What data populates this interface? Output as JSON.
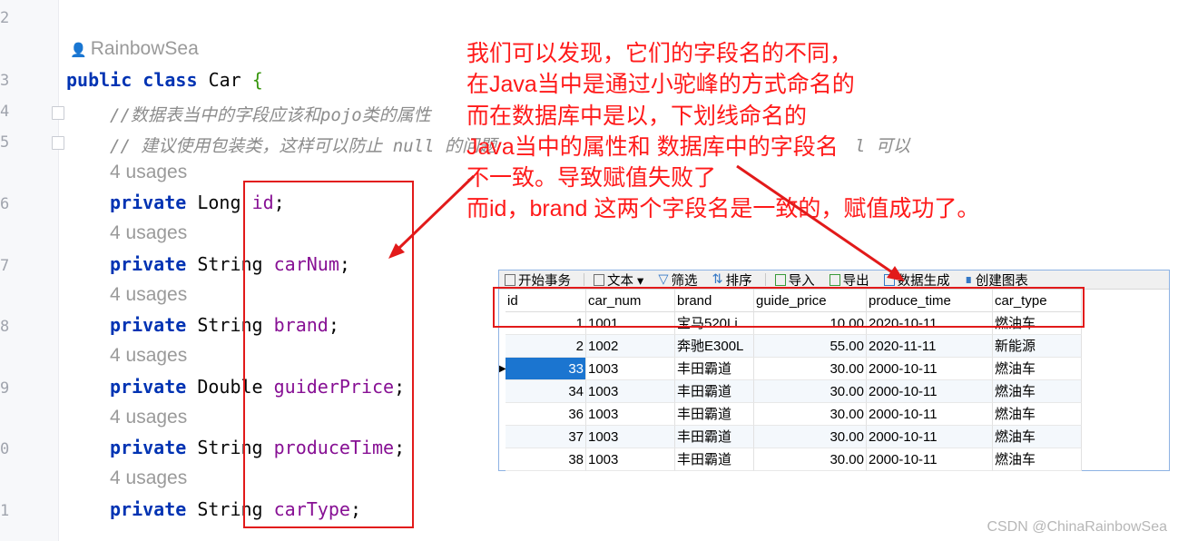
{
  "gutter": {
    "line_numbers": [
      "2",
      "3",
      "4",
      "5",
      "6",
      "7",
      "8",
      "9",
      "0",
      "1"
    ]
  },
  "editor": {
    "author": "RainbowSea",
    "class_decl": {
      "public": "public",
      "class": "class",
      "name": "Car",
      "brace": "{"
    },
    "comment1": "//数据表当中的字段应该和pojo类的属性",
    "comment2": "// 建议使用包装类，这样可以防止 null 的问题",
    "comment2_tail": "l 可以",
    "usages_label": "4 usages",
    "private_kw": "private",
    "fields": [
      {
        "type": "Long",
        "name": "id"
      },
      {
        "type": "String",
        "name": "carNum"
      },
      {
        "type": "String",
        "name": "brand"
      },
      {
        "type": "Double",
        "name": "guiderPrice"
      },
      {
        "type": "String",
        "name": "produceTime"
      },
      {
        "type": "String",
        "name": "carType"
      }
    ],
    "semicolon": ";"
  },
  "annotation": {
    "color": "#ff1a1a",
    "lines": [
      "我们可以发现，它们的字段名的不同，",
      "在Java当中是通过小驼峰的方式命名的",
      "而在数据库中是以，下划线命名的",
      "Java当中的属性和 数据库中的字段名",
      "不一致。导致赋值失败了",
      "而id，brand 这两个字段名是一致的，赋值成功了。"
    ]
  },
  "db_viewer": {
    "toolbar": [
      {
        "label": "开始事务",
        "icon": "transaction-icon"
      },
      {
        "label": "文本 ▾",
        "icon": "text-icon"
      },
      {
        "label": "筛选",
        "icon": "filter-icon"
      },
      {
        "label": "排序",
        "icon": "sort-icon"
      },
      {
        "label": "导入",
        "icon": "import-icon"
      },
      {
        "label": "导出",
        "icon": "export-icon"
      },
      {
        "label": "数据生成",
        "icon": "data-generate-icon"
      },
      {
        "label": "创建图表",
        "icon": "chart-icon"
      }
    ],
    "columns": [
      "id",
      "car_num",
      "brand",
      "guide_price",
      "produce_time",
      "car_type"
    ],
    "rows": [
      [
        "1",
        "1001",
        "宝马520Li",
        "10.00",
        "2020-10-11",
        "燃油车"
      ],
      [
        "2",
        "1002",
        "奔驰E300L",
        "55.00",
        "2020-11-11",
        "新能源"
      ],
      [
        "33",
        "1003",
        "丰田霸道",
        "30.00",
        "2000-10-11",
        "燃油车"
      ],
      [
        "34",
        "1003",
        "丰田霸道",
        "30.00",
        "2000-10-11",
        "燃油车"
      ],
      [
        "36",
        "1003",
        "丰田霸道",
        "30.00",
        "2000-10-11",
        "燃油车"
      ],
      [
        "37",
        "1003",
        "丰田霸道",
        "30.00",
        "2000-10-11",
        "燃油车"
      ],
      [
        "38",
        "1003",
        "丰田霸道",
        "30.00",
        "2000-10-11",
        "燃油车"
      ]
    ],
    "selected_row": 2,
    "selection_color": "#1b75d0"
  },
  "watermark": "CSDN @ChinaRainbowSea"
}
